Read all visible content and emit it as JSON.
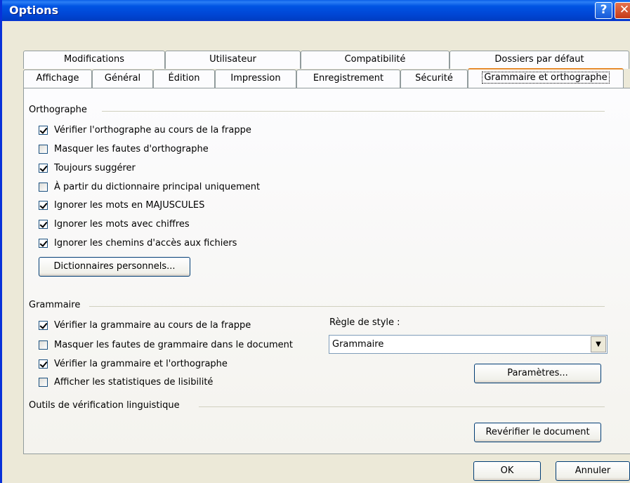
{
  "window": {
    "title": "Options",
    "help_glyph": "?",
    "close_glyph": "✕"
  },
  "tabs_back": [
    "Modifications",
    "Utilisateur",
    "Compatibilité",
    "Dossiers par défaut"
  ],
  "tabs_front": [
    "Affichage",
    "Général",
    "Édition",
    "Impression",
    "Enregistrement",
    "Sécurité",
    "Grammaire et orthographe"
  ],
  "active_tab": "Grammaire et orthographe",
  "orthographe": {
    "title": "Orthographe",
    "options": [
      {
        "label": "Vérifier l'orthographe au cours de la frappe",
        "checked": true
      },
      {
        "label": "Masquer les fautes d'orthographe",
        "checked": false
      },
      {
        "label": "Toujours suggérer",
        "checked": true
      },
      {
        "label": "À partir du dictionnaire principal uniquement",
        "checked": false
      },
      {
        "label": "Ignorer les mots en MAJUSCULES",
        "checked": true
      },
      {
        "label": "Ignorer les mots avec chiffres",
        "checked": true
      },
      {
        "label": "Ignorer les chemins d'accès aux fichiers",
        "checked": true
      }
    ],
    "dictionaries_button": "Dictionnaires personnels..."
  },
  "grammaire": {
    "title": "Grammaire",
    "options": [
      {
        "label": "Vérifier la grammaire au cours de la frappe",
        "checked": true
      },
      {
        "label": "Masquer les fautes de grammaire dans le document",
        "checked": false
      },
      {
        "label": "Vérifier la grammaire et l'orthographe",
        "checked": true
      },
      {
        "label": "Afficher les statistiques de lisibilité",
        "checked": false
      }
    ],
    "style_rule_label": "Règle de style :",
    "style_rule_value": "Grammaire",
    "settings_button": "Paramètres..."
  },
  "outils": {
    "title": "Outils de vérification linguistique",
    "recheck_button": "Revérifier le document"
  },
  "footer": {
    "ok": "OK",
    "cancel": "Annuler"
  }
}
